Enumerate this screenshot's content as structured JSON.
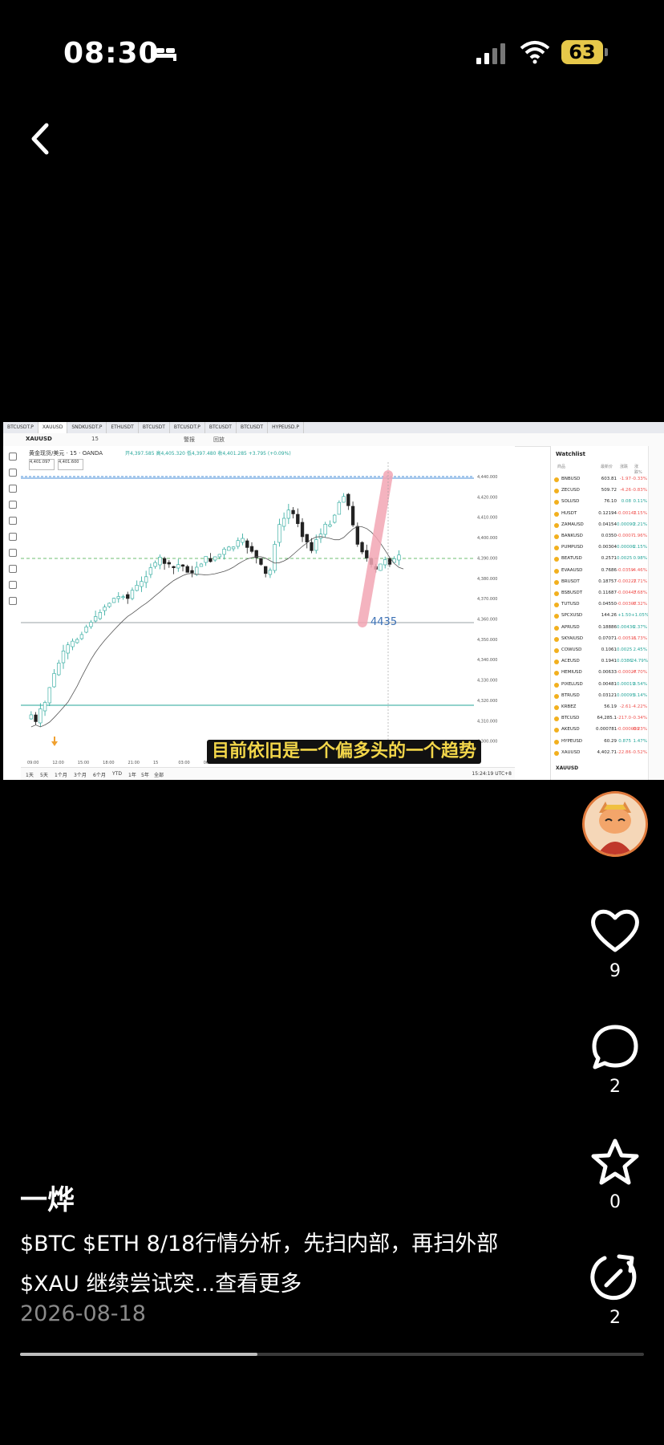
{
  "status_bar": {
    "time": "08:30",
    "battery": "63",
    "accent": "#e6c84a"
  },
  "icons": {
    "back": "chevron-left-icon",
    "like": "heart-icon",
    "comment": "comment-icon",
    "favorite": "star-icon",
    "share": "share-icon"
  },
  "video": {
    "tabs": [
      "BTCUSDT.P",
      "XAUUSD",
      "SNDKUSDT.P",
      "ETHUSDT",
      "BTCUSDT",
      "BTCUSDT.P",
      "BTCUSDT",
      "BTCUSDT",
      "HYPEUSD.P"
    ],
    "toolbar": {
      "symbol": "XAUUSD",
      "interval": "15",
      "alert": "警报",
      "replay": "回放"
    },
    "chart": {
      "title": "黄金现货/美元 · 15 · OANDA",
      "ohlc": "开4,397.585 高4,405.320 低4,397.480 收4,401.285 +3.795 (+0.09%)",
      "price_sell": "4,401.097",
      "price_buy": "4,401.600",
      "level_label": "4435",
      "subtitle": "目前依旧是一个偏多头的一个趋势",
      "price_ticks": [
        "4,440.000",
        "4,420.000",
        "4,410.000",
        "4,400.000",
        "4,390.000",
        "4,380.000",
        "4,370.000",
        "4,360.000",
        "4,350.000",
        "4,340.000",
        "4,330.000",
        "4,320.000",
        "4,310.000",
        "4,300.000"
      ],
      "time_ticks": [
        "09:00",
        "12:00",
        "15:00",
        "18:00",
        "21:00",
        "15",
        "03:00",
        "06:00",
        "09:00",
        "12:00",
        "15:00",
        "18:00",
        "21:00",
        "16",
        "03:00",
        "06:00",
        "09:00",
        "12:00"
      ]
    },
    "timeframes": [
      "1天",
      "5天",
      "1个月",
      "3个月",
      "6个月",
      "YTD",
      "1年",
      "5年",
      "全部"
    ],
    "clock": "15:24:19 UTC+8",
    "watchlist": {
      "title": "Watchlist",
      "headers": [
        "商品",
        "最新价",
        "涨跌",
        "涨跌%"
      ],
      "rows": [
        {
          "sym": "BNBUSD",
          "last": "603.81",
          "chg": "-1.97",
          "pct": "-0.33%",
          "dir": "down"
        },
        {
          "sym": "ZECUSD",
          "last": "509.72",
          "chg": "-4.26",
          "pct": "-0.83%",
          "dir": "down"
        },
        {
          "sym": "SOLUSD",
          "last": "76.10",
          "chg": "0.08",
          "pct": "0.11%",
          "dir": "up"
        },
        {
          "sym": "HUSDT",
          "last": "0.12194",
          "chg": "-0.00142",
          "pct": "-1.15%",
          "dir": "down"
        },
        {
          "sym": "ZAMAUSD",
          "last": "0.04154",
          "chg": "0.00090",
          "pct": "2.21%",
          "dir": "up"
        },
        {
          "sym": "BANKUSD",
          "last": "0.0350",
          "chg": "-0.0007",
          "pct": "-1.96%",
          "dir": "down"
        },
        {
          "sym": "PUMPUSD",
          "last": "0.00304",
          "chg": "0.00006",
          "pct": "2.15%",
          "dir": "up"
        },
        {
          "sym": "BEATUSD",
          "last": "0.2571",
          "chg": "0.0025",
          "pct": "0.98%",
          "dir": "up"
        },
        {
          "sym": "EVAAUSD",
          "last": "0.7686",
          "chg": "-0.0359",
          "pct": "-4.46%",
          "dir": "down"
        },
        {
          "sym": "BRUSDT",
          "last": "0.18757",
          "chg": "-0.00227",
          "pct": "-1.71%",
          "dir": "down"
        },
        {
          "sym": "BSBUSDT",
          "last": "0.11687",
          "chg": "-0.00447",
          "pct": "-3.68%",
          "dir": "down"
        },
        {
          "sym": "TUTUSD",
          "last": "0.04550",
          "chg": "-0.00307",
          "pct": "-6.32%",
          "dir": "down"
        },
        {
          "sym": "SPCXUSD",
          "last": "144.26",
          "chg": "+1.50",
          "pct": "+1.05%",
          "dir": "up"
        },
        {
          "sym": "APRUSD",
          "last": "0.18886",
          "chg": "0.00436",
          "pct": "2.37%",
          "dir": "up"
        },
        {
          "sym": "SKYAIUSD",
          "last": "0.07071",
          "chg": "-0.00511",
          "pct": "-6.73%",
          "dir": "down"
        },
        {
          "sym": "COWUSD",
          "last": "0.1061",
          "chg": "0.0025",
          "pct": "2.45%",
          "dir": "up"
        },
        {
          "sym": "ACEUSD",
          "last": "0.1941",
          "chg": "0.0386",
          "pct": "24.79%",
          "dir": "up"
        },
        {
          "sym": "HEMIUSD",
          "last": "0.00633",
          "chg": "-0.00027",
          "pct": "-4.70%",
          "dir": "down"
        },
        {
          "sym": "PIXELUSD",
          "last": "0.00481",
          "chg": "0.00019",
          "pct": "3.54%",
          "dir": "up"
        },
        {
          "sym": "BTRUSD",
          "last": "0.03121",
          "chg": "0.00095",
          "pct": "3.14%",
          "dir": "up"
        },
        {
          "sym": "KRBEZ",
          "last": "56.19",
          "chg": "-2.61",
          "pct": "-4.22%",
          "dir": "down"
        },
        {
          "sym": "BTCUSD",
          "last": "64,285.1",
          "chg": "-217.0",
          "pct": "-0.34%",
          "dir": "down"
        },
        {
          "sym": "AKEUSD",
          "last": "0.000781",
          "chg": "-0.000009",
          "pct": "-0.23%",
          "dir": "down"
        },
        {
          "sym": "HYPEUSD",
          "last": "60.29",
          "chg": "0.875",
          "pct": "1.47%",
          "dir": "up"
        },
        {
          "sym": "XAUUSD",
          "last": "4,402.71",
          "chg": "-22.86",
          "pct": "-0.52%",
          "dir": "down"
        }
      ],
      "footer": "XAUUSD"
    }
  },
  "actions": {
    "like_count": "9",
    "comment_count": "2",
    "favorite_count": "0",
    "share_count": "2"
  },
  "post": {
    "author": "一烨",
    "desc_line1": "$BTC $ETH 8/18行情分析，先扫内部，再扫外部",
    "desc_line2": "$XAU 继续尝试突...",
    "more_label": "查看更多",
    "date": "2026-08-18",
    "progress": 0.38
  }
}
